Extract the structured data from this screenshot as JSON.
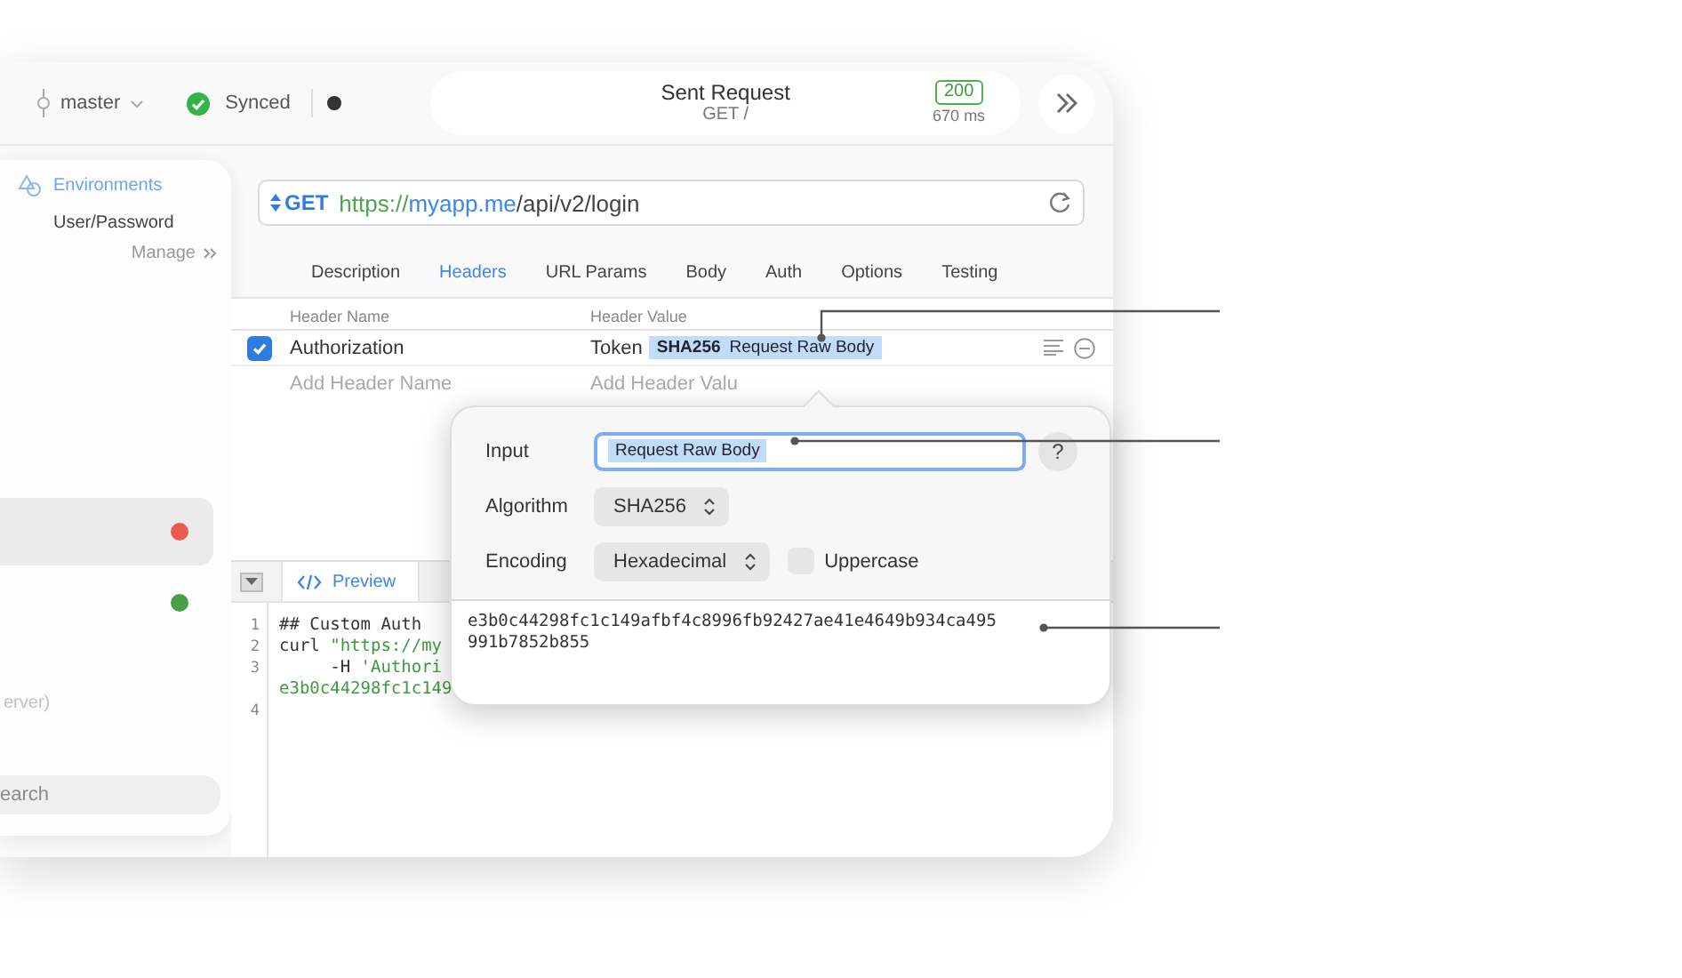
{
  "toolbar": {
    "branch": "master",
    "sync_status": "Synced",
    "request": {
      "title": "Sent Request",
      "subtitle": "GET /",
      "status_code": "200",
      "duration": "670 ms"
    }
  },
  "sidebar": {
    "environments_title": "Environments",
    "environment": "User/Password",
    "manage": "Manage",
    "items": [
      {
        "selected": true,
        "color": "#ec5a4f"
      },
      {
        "selected": false,
        "color": "#4c9f47"
      }
    ],
    "faded_label": "erver)",
    "search": {
      "placeholder": "earch"
    }
  },
  "request": {
    "method": "GET",
    "url": {
      "scheme": "https://",
      "host": "myapp.me",
      "path": "/api/v2/login"
    }
  },
  "tabs": [
    {
      "label": "Description",
      "selected": false
    },
    {
      "label": "Headers",
      "selected": true
    },
    {
      "label": "URL Params",
      "selected": false
    },
    {
      "label": "Body",
      "selected": false
    },
    {
      "label": "Auth",
      "selected": false
    },
    {
      "label": "Options",
      "selected": false
    },
    {
      "label": "Testing",
      "selected": false
    }
  ],
  "headers": {
    "columns": [
      "Header Name",
      "Header Value"
    ],
    "rows": [
      {
        "enabled": true,
        "name": "Authorization",
        "value_prefix": "Token",
        "token": {
          "algorithm": "SHA256",
          "input": "Request Raw Body"
        }
      }
    ],
    "new_row": {
      "name_placeholder": "Add Header Name",
      "value_placeholder": "Add Header Valu"
    }
  },
  "preview": {
    "tab": "Preview",
    "lines": [
      {
        "number": "1",
        "segments": [
          {
            "kind": "plain",
            "text": "## Custom Auth"
          }
        ]
      },
      {
        "number": "2",
        "segments": [
          {
            "kind": "plain",
            "text": "curl "
          },
          {
            "kind": "string",
            "text": "\"https://my"
          }
        ]
      },
      {
        "number": "3",
        "segments": [
          {
            "kind": "plain",
            "text": "     -H "
          },
          {
            "kind": "string",
            "text": "'Authori"
          }
        ]
      },
      {
        "segments": [
          {
            "kind": "string",
            "text": "e3b0c44298fc1c149"
          }
        ]
      },
      {
        "number": "4"
      }
    ]
  },
  "hash_popover": {
    "input_label": "Input",
    "input_token": "Request Raw Body",
    "help": "?",
    "algorithm_label": "Algorithm",
    "algorithm": "SHA256",
    "encoding_label": "Encoding",
    "encoding": "Hexadecimal",
    "uppercase": {
      "label": "Uppercase",
      "checked": false
    },
    "output": "e3b0c44298fc1c149afbf4c8996fb92427ae41e4649b934ca495991b7852b855"
  }
}
